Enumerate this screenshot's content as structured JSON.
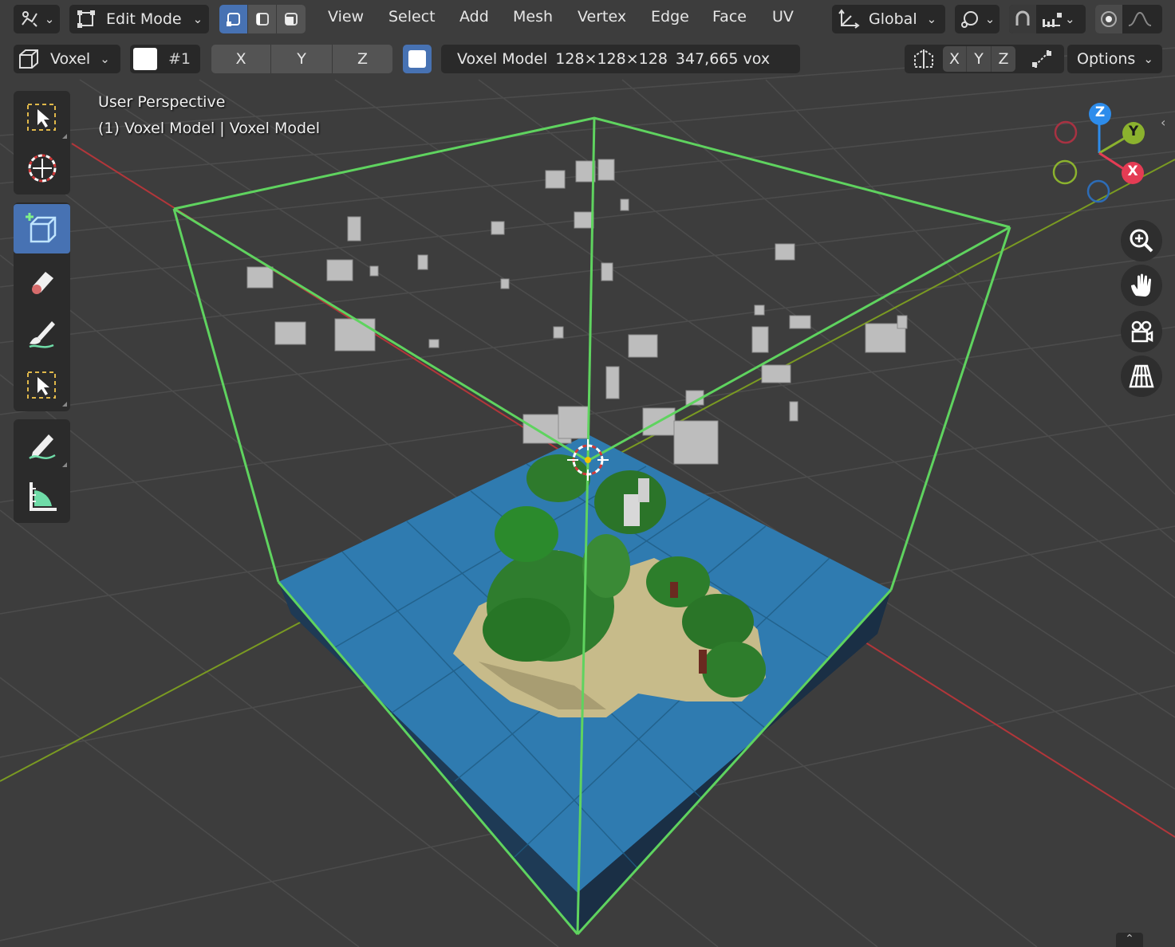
{
  "header": {
    "editor_type_icon": "viewport-editor-icon",
    "mode": {
      "label": "Edit Mode",
      "icon": "edit-mode-icon"
    },
    "select_modes": [
      "vertex-select-icon",
      "edge-select-icon",
      "face-select-icon"
    ],
    "menus": [
      "View",
      "Select",
      "Add",
      "Mesh",
      "Vertex",
      "Edge",
      "Face",
      "UV"
    ],
    "transform_orientation": "Global",
    "pivot_icon": "pivot-point-icon",
    "snap_icon": "snap-magnet-icon",
    "snap_target_icon": "snap-increment-icon",
    "proportional_icon": "proportional-edit-icon",
    "falloff_icon": "falloff-curve-icon"
  },
  "tool_header": {
    "brush_type": "Voxel",
    "color_swatch": "#ffffff",
    "color_index": "#1",
    "axes": [
      "X",
      "Y",
      "Z"
    ],
    "checkbox_checked": true,
    "model_name": "Voxel Model",
    "dimensions": "128×128×128",
    "voxel_count": "347,665 vox",
    "mirror_axes": [
      "X",
      "Y",
      "Z"
    ],
    "options_label": "Options"
  },
  "viewport": {
    "view_name": "User Perspective",
    "object_info": "(1) Voxel Model | Voxel Model"
  },
  "toolbar": {
    "tools": [
      {
        "name": "select-box-tool",
        "icon": "select-box-icon",
        "active": false
      },
      {
        "name": "cursor-tool",
        "icon": "cursor-icon",
        "active": false
      },
      {
        "name": "add-voxel-tool",
        "icon": "add-cube-icon",
        "active": true
      },
      {
        "name": "erase-tool",
        "icon": "eraser-icon",
        "active": false
      },
      {
        "name": "paint-tool",
        "icon": "paint-brush-icon",
        "active": false
      },
      {
        "name": "voxel-select-tool",
        "icon": "select-box-icon",
        "active": false
      },
      {
        "name": "annotate-tool",
        "icon": "annotate-icon",
        "active": false
      },
      {
        "name": "measure-tool",
        "icon": "measure-icon",
        "active": false
      }
    ]
  },
  "gizmo": {
    "axis_labels": {
      "x": "X",
      "y": "Y",
      "z": "Z"
    },
    "colors": {
      "x": "#e43c54",
      "y": "#8bb22e",
      "z": "#2d8ceb",
      "selection": "#5fd35f"
    }
  },
  "navigation": [
    "zoom-icon",
    "hand-pan-icon",
    "camera-icon",
    "perspective-grid-icon"
  ]
}
